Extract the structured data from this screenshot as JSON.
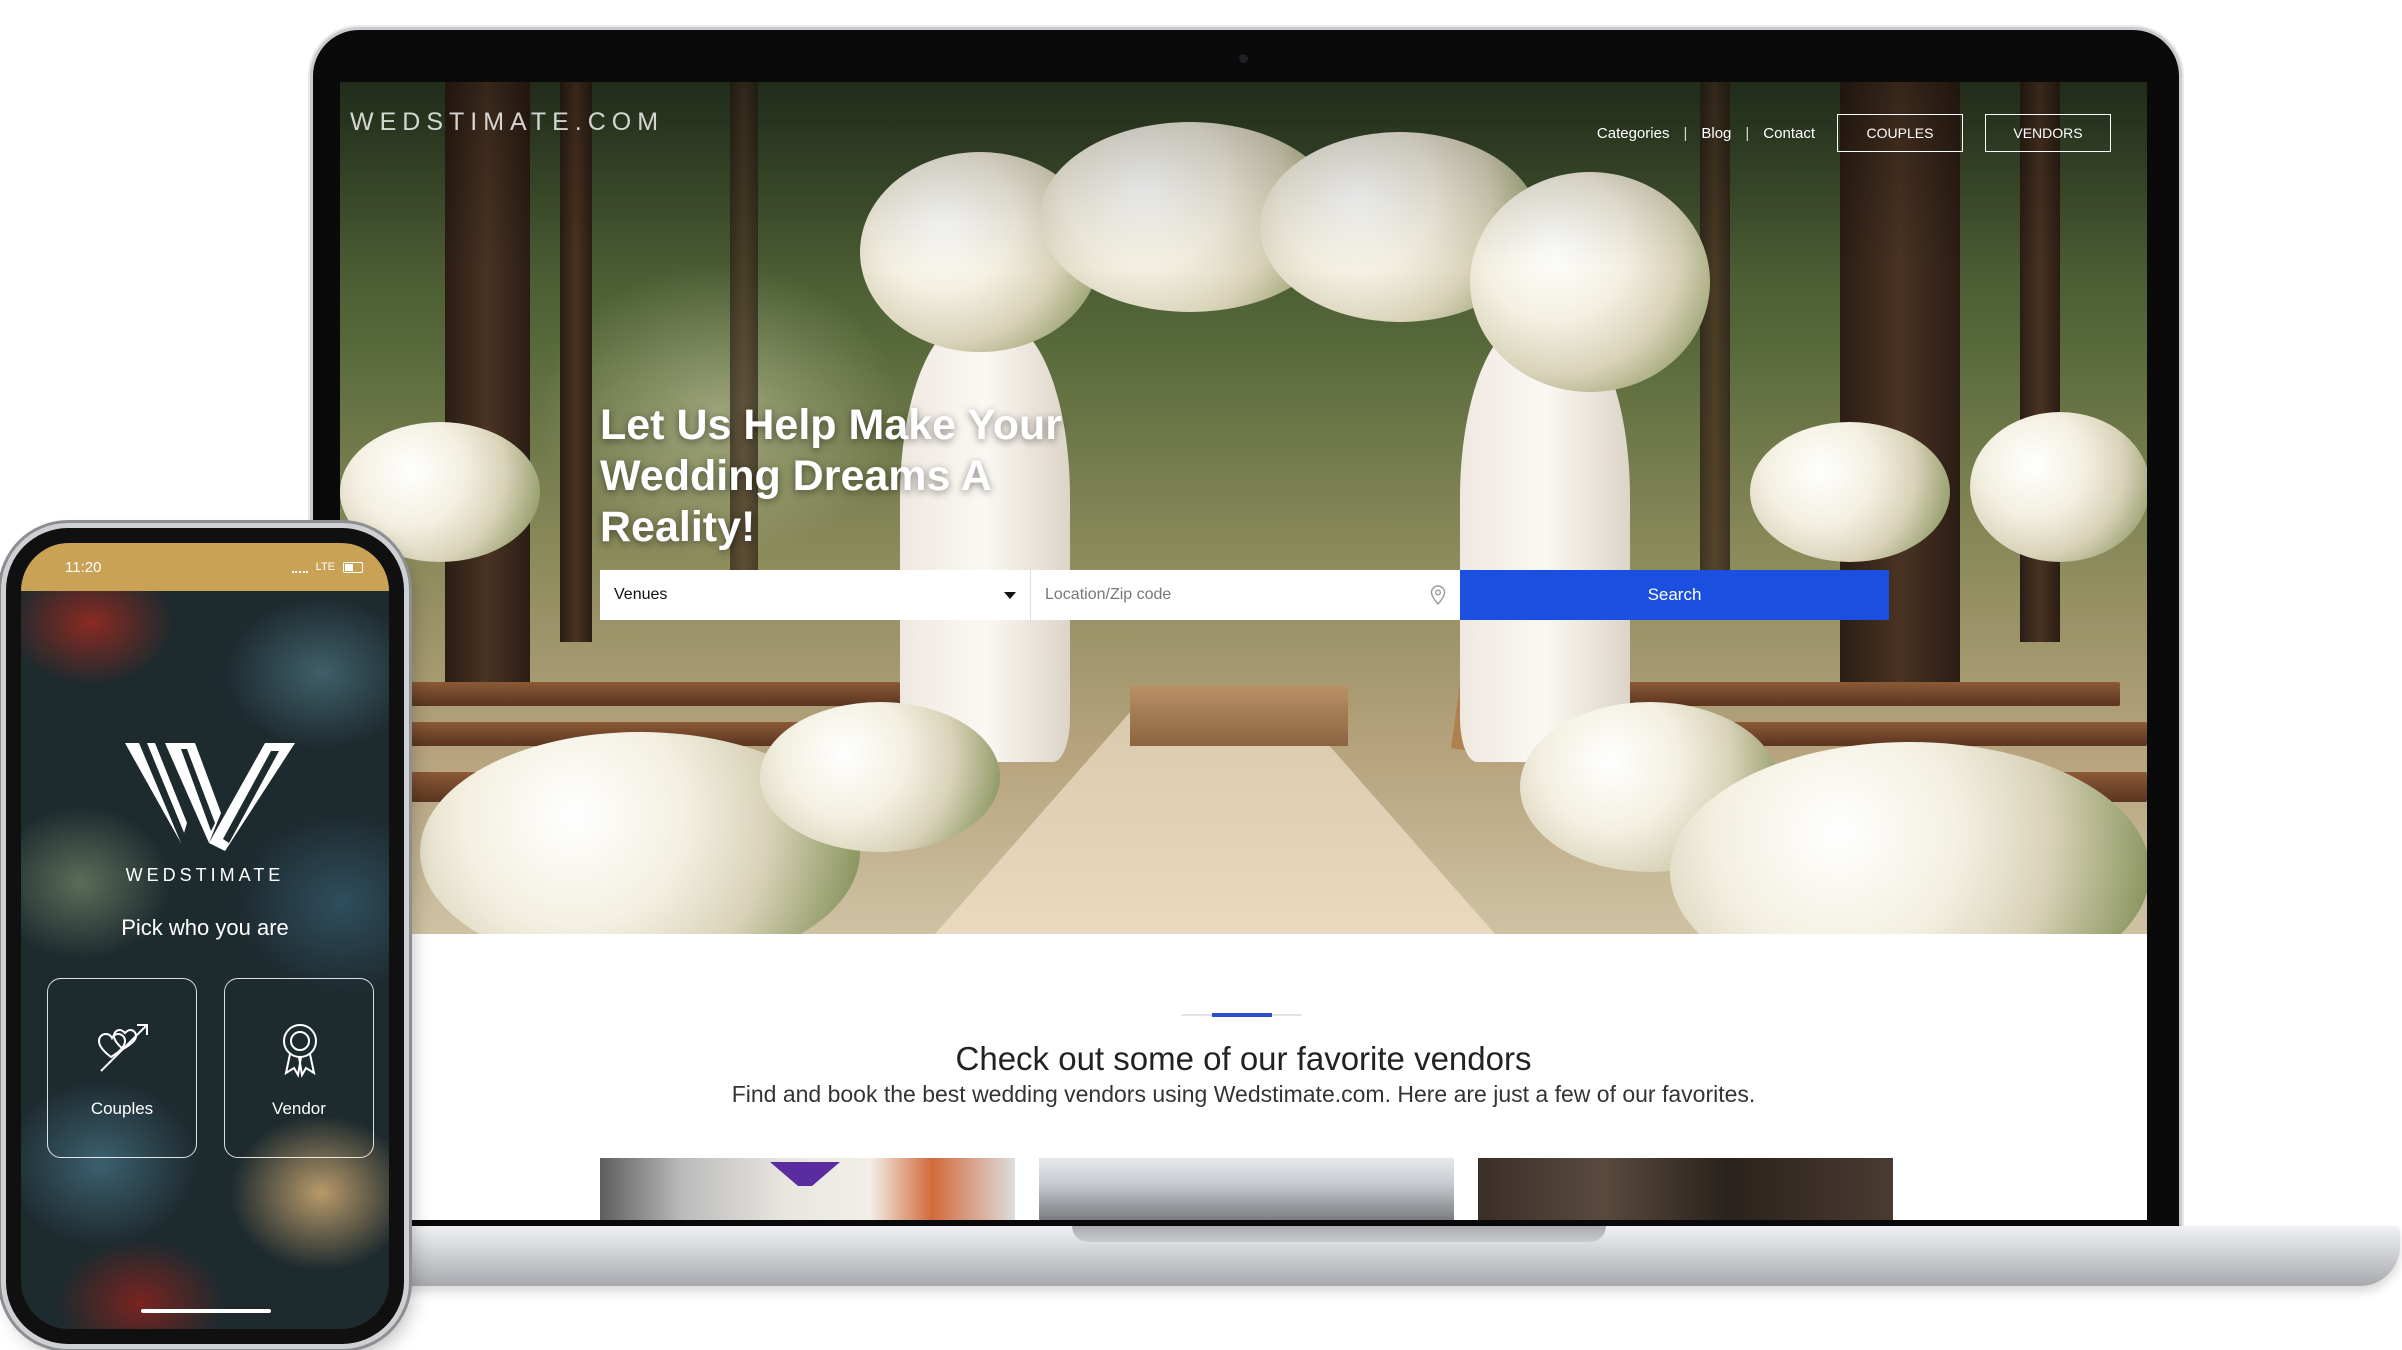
{
  "laptop": {
    "site": {
      "logo": "WEDSTIMATE.COM",
      "nav": {
        "categories": "Categories",
        "blog": "Blog",
        "contact": "Contact",
        "couples_button": "COUPLES",
        "vendors_button": "VENDORS",
        "separator": "|"
      },
      "hero": {
        "headline": "Let Us Help Make Your Wedding Dreams A Reality!"
      },
      "search": {
        "category_value": "Venues",
        "location_placeholder": "Location/Zip code",
        "search_button": "Search"
      },
      "vendors_section": {
        "title": "Check out some of our favorite vendors",
        "subtitle": "Find and book the best wedding vendors using Wedstimate.com. Here are just a few of our favorites."
      }
    }
  },
  "phone": {
    "status": {
      "time": "11:20",
      "network": "LTE"
    },
    "brand": "WEDSTIMATE",
    "prompt": "Pick who you are",
    "choices": {
      "couples": "Couples",
      "vendor": "Vendor"
    }
  },
  "colors": {
    "accent_blue": "#1a4fe0",
    "status_gold": "#c9a255"
  }
}
